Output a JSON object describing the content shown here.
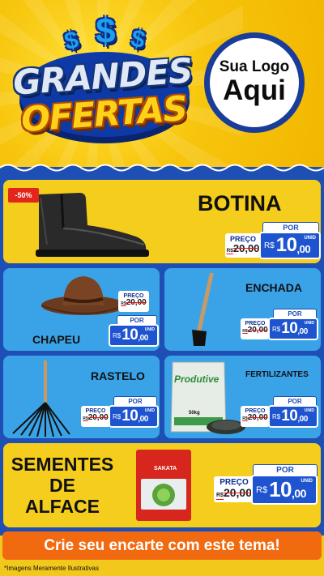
{
  "header": {
    "title_line1": "GRANDES",
    "title_line2": "OFERTAS",
    "dollar_sign": "$",
    "logo_line1": "Sua Logo",
    "logo_line2": "Aqui"
  },
  "labels": {
    "preco": "PREÇO",
    "por": "POR",
    "de": "R$",
    "currency": "R$",
    "unid": "UNID"
  },
  "products": {
    "botina": {
      "name": "BOTINA",
      "discount": "-50%",
      "old_price": "20,00",
      "new_int": "10",
      "new_dec": ",00"
    },
    "chapeu": {
      "name": "CHAPEU",
      "old_price": "20,00",
      "new_int": "10",
      "new_dec": ",00"
    },
    "enchada": {
      "name": "ENCHADA",
      "old_price": "20,00",
      "new_int": "10",
      "new_dec": ",00"
    },
    "rastelo": {
      "name": "RASTELO",
      "old_price": "20,00",
      "new_int": "10",
      "new_dec": ",00"
    },
    "fertilizantes": {
      "name": "FERTILIZANTES",
      "bag_brand": "Produtive",
      "bag_weight": "50kg",
      "old_price": "20,00",
      "new_int": "10",
      "new_dec": ",00"
    },
    "sementes": {
      "name_l1": "SEMENTES",
      "name_l2": "DE",
      "name_l3": "ALFACE",
      "packet_brand": "SAKATA",
      "old_price": "20,00",
      "new_int": "10",
      "new_dec": ",00"
    }
  },
  "cta": "Crie seu encarte com este tema!",
  "footer_note": "*Imagens Meramente Ilustrativas",
  "colors": {
    "yellow": "#f5cd1c",
    "light_blue": "#3aa3e8",
    "dark_blue": "#1e4fb4",
    "orange": "#f26a10",
    "red": "#e3261c"
  }
}
